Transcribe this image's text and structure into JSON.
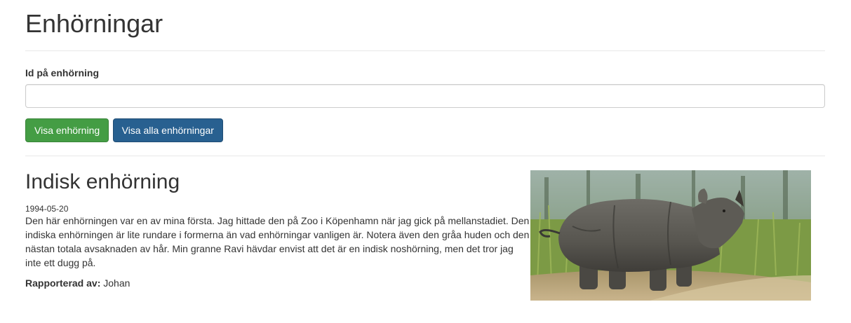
{
  "page": {
    "title": "Enhörningar"
  },
  "form": {
    "id_label": "Id på enhörning",
    "id_value": "",
    "show_button": "Visa enhörning",
    "show_all_button": "Visa alla enhörningar"
  },
  "colors": {
    "success": "#449d44",
    "primary": "#286090"
  },
  "unicorn": {
    "name": "Indisk enhörning",
    "date": "1994-05-20",
    "description": "Den här enhörningen var en av mina första. Jag hittade den på Zoo i Köpenhamn när jag gick på mellanstadiet. Den indiska enhörningen är lite rundare i formerna än vad enhörningar vanligen är. Notera även den gråa huden och den nästan totala avsaknaden av hår. Min granne Ravi hävdar envist att det är en indisk noshörning, men det tror jag inte ett dugg på.",
    "reported_by_label": "Rapporterad av:",
    "reported_by": "Johan",
    "image_subject": "rhinoceros-photo"
  }
}
